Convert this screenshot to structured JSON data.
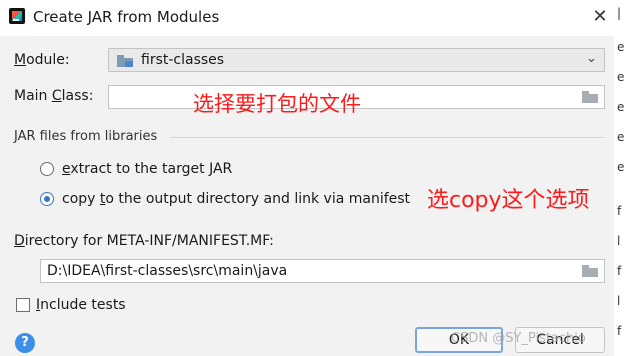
{
  "window": {
    "title": "Create JAR from Modules",
    "app_icon": "intellij-idea-icon",
    "close_icon": "close-icon"
  },
  "module": {
    "label_pre": "",
    "label_mnemonic": "M",
    "label_post": "odule:",
    "value": "first-classes",
    "icon": "module-folder-icon"
  },
  "main_class": {
    "label_pre": "Main ",
    "label_mnemonic": "C",
    "label_post": "lass:",
    "value": ""
  },
  "jar_section": {
    "label": "JAR files from libraries"
  },
  "options": {
    "extract": {
      "pre": "",
      "mnemonic": "e",
      "post": "xtract to the target JAR",
      "selected": false
    },
    "copy": {
      "pre": "copy ",
      "mnemonic": "t",
      "post": "o the output directory and link via manifest",
      "selected": true
    }
  },
  "directory": {
    "label_pre": "",
    "label_mnemonic": "D",
    "label_post": "irectory for META-INF/MANIFEST.MF:",
    "value": "D:\\IDEA\\first-classes\\src\\main\\java"
  },
  "include_tests": {
    "pre": "",
    "mnemonic": "I",
    "post": "nclude tests",
    "checked": false
  },
  "buttons": {
    "help": "?",
    "ok": "OK",
    "cancel": "Cancel"
  },
  "annotations": {
    "main_class_note": "选择要打包的文件",
    "copy_note": "选copy这个选项"
  },
  "watermark": "CSDN @SY_Pistachio",
  "colors": {
    "accent": "#3a74c9",
    "annotation": "#ff1a1a",
    "dialog_bg": "#f2f2f2"
  }
}
